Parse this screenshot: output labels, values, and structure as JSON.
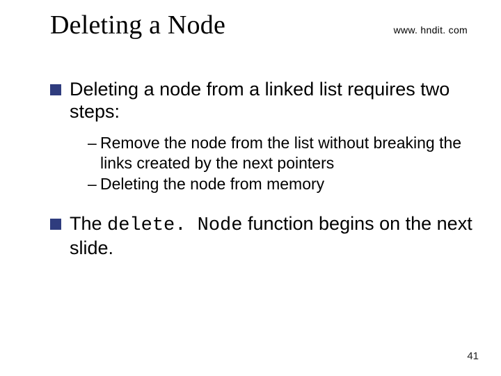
{
  "header": {
    "title": "Deleting a Node",
    "url": "www. hndit. com"
  },
  "body": {
    "point1": "Deleting a node from a linked list requires two steps:",
    "sub1": "Remove the node from the list without breaking the links created by the next pointers",
    "sub2": "Deleting the node from memory",
    "point2_pre": "The ",
    "point2_code": "delete. Node",
    "point2_post": " function begins on the next slide."
  },
  "pagenum": "41"
}
